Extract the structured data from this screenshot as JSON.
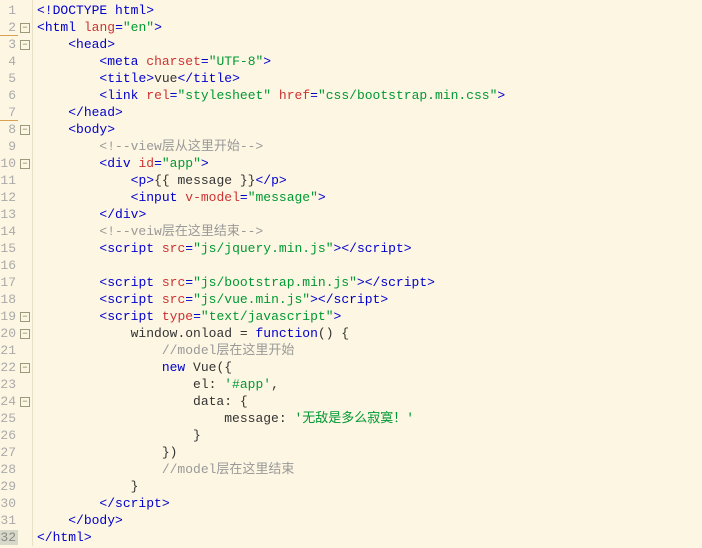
{
  "gutter": [
    {
      "n": "1",
      "fold": false,
      "mod": false
    },
    {
      "n": "2",
      "fold": true,
      "mod": true
    },
    {
      "n": "3",
      "fold": true,
      "mod": false
    },
    {
      "n": "4",
      "fold": false,
      "mod": false
    },
    {
      "n": "5",
      "fold": false,
      "mod": false
    },
    {
      "n": "6",
      "fold": false,
      "mod": false
    },
    {
      "n": "7",
      "fold": false,
      "mod": true
    },
    {
      "n": "8",
      "fold": true,
      "mod": false
    },
    {
      "n": "9",
      "fold": false,
      "mod": false
    },
    {
      "n": "10",
      "fold": true,
      "mod": false
    },
    {
      "n": "11",
      "fold": false,
      "mod": false
    },
    {
      "n": "12",
      "fold": false,
      "mod": false
    },
    {
      "n": "13",
      "fold": false,
      "mod": false
    },
    {
      "n": "14",
      "fold": false,
      "mod": false
    },
    {
      "n": "15",
      "fold": false,
      "mod": false
    },
    {
      "n": "16",
      "fold": false,
      "mod": false
    },
    {
      "n": "17",
      "fold": false,
      "mod": false
    },
    {
      "n": "18",
      "fold": false,
      "mod": false
    },
    {
      "n": "19",
      "fold": true,
      "mod": false
    },
    {
      "n": "20",
      "fold": true,
      "mod": false
    },
    {
      "n": "21",
      "fold": false,
      "mod": false
    },
    {
      "n": "22",
      "fold": true,
      "mod": false
    },
    {
      "n": "23",
      "fold": false,
      "mod": false
    },
    {
      "n": "24",
      "fold": true,
      "mod": false
    },
    {
      "n": "25",
      "fold": false,
      "mod": false
    },
    {
      "n": "26",
      "fold": false,
      "mod": false
    },
    {
      "n": "27",
      "fold": false,
      "mod": false
    },
    {
      "n": "28",
      "fold": false,
      "mod": false
    },
    {
      "n": "29",
      "fold": false,
      "mod": false
    },
    {
      "n": "30",
      "fold": false,
      "mod": false
    },
    {
      "n": "31",
      "fold": false,
      "mod": false
    },
    {
      "n": "32",
      "fold": false,
      "mod": false,
      "current": true
    }
  ],
  "tokens": {
    "doctype": "<!DOCTYPE html>",
    "html_open_1": "<",
    "html_tag": "html",
    "sp": " ",
    "lang_attr": "lang",
    "eq": "=",
    "lang_val": "\"en\"",
    "close": ">",
    "head_open": "<",
    "head_tag": "head",
    "head_close": ">",
    "meta_open": "<",
    "meta_tag": "meta",
    "charset_attr": "charset",
    "charset_val": "\"UTF-8\"",
    "title_open": "<",
    "title_tag": "title",
    "title_txt": "vue",
    "title_end": "</",
    "title_endtag": "title",
    "link_open": "<",
    "link_tag": "link",
    "rel_attr": "rel",
    "rel_val": "\"stylesheet\"",
    "href_attr": "href",
    "href_val": "\"css/bootstrap.min.css\"",
    "head_end": "</",
    "head_endtag": "head",
    "body_open": "<",
    "body_tag": "body",
    "body_close": ">",
    "cmt1": "<!--view层从这里开始-->",
    "div_open": "<",
    "div_tag": "div",
    "id_attr": "id",
    "id_val": "\"app\"",
    "p_open": "<",
    "p_tag": "p",
    "p_txt": "{{ message }}",
    "p_end": "</",
    "p_endtag": "p",
    "input_open": "<",
    "input_tag": "input",
    "vmodel_attr": "v-model",
    "vmodel_val": "\"message\"",
    "div_end": "</",
    "div_endtag": "div",
    "cmt2": "<!--veiw层在这里结束-->",
    "script_open": "<",
    "script_tag": "script",
    "src_attr": "src",
    "src1_val": "\"js/jquery.min.js\"",
    "script_end": "</",
    "script_endtag": "script",
    "src2_val": "\"js/bootstrap.min.js\"",
    "src3_val": "\"js/vue.min.js\"",
    "type_attr": "type",
    "type_val": "\"text/javascript\"",
    "js_window": "window",
    "js_dot": ".",
    "js_onload": "onload",
    "js_eq": " = ",
    "js_func": "function",
    "js_paren": "() {",
    "cmt3": "//model层在这里开始",
    "js_new": "new",
    "js_vue": " Vue",
    "js_open": "({",
    "js_el": "el",
    "js_colon": ": ",
    "js_elval": "'#app'",
    "js_comma": ",",
    "js_data": "data",
    "js_dopen": ": {",
    "js_msg": "message",
    "js_msgval": "'无敌是多么寂寞！'",
    "js_cbrace": "}",
    "js_cparen": "})",
    "cmt4": "//model层在这里结束",
    "body_end": "</",
    "body_endtag": "body",
    "html_end": "</",
    "html_endtag": "html"
  }
}
